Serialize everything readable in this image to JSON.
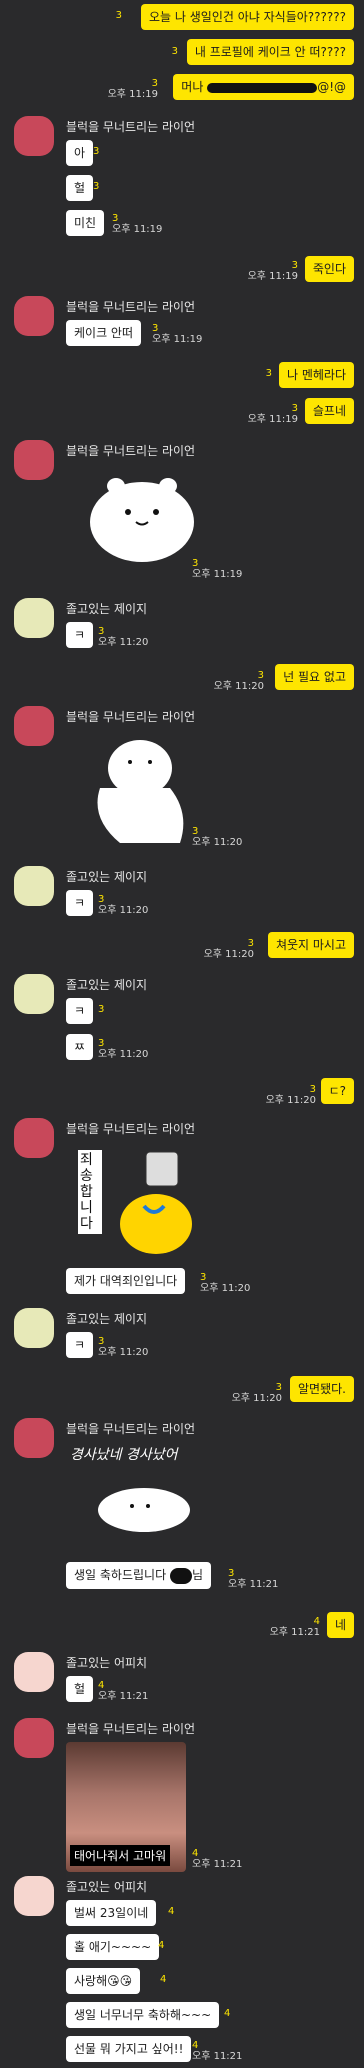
{
  "messages": {
    "me1": {
      "text": "오늘 나 생일인건 아냐 자식들아??????",
      "count": "3"
    },
    "me2": {
      "text": "내 프로필에 케이크 안 떠????",
      "count": "3"
    },
    "me3": {
      "text": "머나 ",
      "suffix": "@!@",
      "count": "3",
      "time": "오후 11:19"
    },
    "r1_name": "블럭을 무너트리는 라이언",
    "r1_a": {
      "text": "아",
      "count": "3"
    },
    "r1_b": {
      "text": "헐",
      "count": "3"
    },
    "r1_c": {
      "text": "미친",
      "count": "3",
      "time": "오후 11:19"
    },
    "me4": {
      "text": "죽인다",
      "count": "3",
      "time": "오후 11:19"
    },
    "r2_name": "블럭을 무너트리는 라이언",
    "r2_a": {
      "text": "케이크 안떠",
      "count": "3",
      "time": "오후 11:19"
    },
    "me5": {
      "text": "나 멘헤라다",
      "count": "3"
    },
    "me6": {
      "text": "슬프네",
      "count": "3",
      "time": "오후 11:19"
    },
    "r3_name": "블럭을 무너트리는 라이언",
    "r3_sticker": {
      "count": "3",
      "time": "오후 11:19"
    },
    "j1_name": "졸고있는 제이지",
    "j1_a": {
      "text": "ㅋ",
      "count": "3",
      "time": "오후 11:20"
    },
    "me7": {
      "text": "넌 필요 없고",
      "count": "3",
      "time": "오후 11:20"
    },
    "r4_name": "블럭을 무너트리는 라이언",
    "r4_sticker": {
      "count": "3",
      "time": "오후 11:20"
    },
    "j2_name": "졸고있는 제이지",
    "j2_a": {
      "text": "ㅋ",
      "count": "3",
      "time": "오후 11:20"
    },
    "me8": {
      "text": "쳐웃지 마시고",
      "count": "3",
      "time": "오후 11:20"
    },
    "j3_name": "졸고있는 제이지",
    "j3_a": {
      "text": "ㅋ",
      "count": "3"
    },
    "j3_b": {
      "text": "ㅉ",
      "count": "3",
      "time": "오후 11:20"
    },
    "me9": {
      "text": "ㄷ?",
      "count": "3",
      "time": "오후 11:20"
    },
    "r5_name": "블럭을 무너트리는 라이언",
    "r5_sticker_text": "죄송합니다",
    "r5_a": {
      "text": "제가 대역죄인입니다",
      "count": "3",
      "time": "오후 11:20"
    },
    "j4_name": "졸고있는 제이지",
    "j4_a": {
      "text": "ㅋ",
      "count": "3",
      "time": "오후 11:20"
    },
    "me10": {
      "text": "알면됐다.",
      "count": "3",
      "time": "오후 11:20"
    },
    "r6_name": "블럭을 무너트리는 라이언",
    "r6_sticker_text": "경사났네 경사났어",
    "r6_a": {
      "text": "생일 축하드립니다 ",
      "suffix": "님",
      "count": "3",
      "time": "오후 11:21"
    },
    "me11": {
      "text": "네",
      "count": "4",
      "time": "오후 11:21"
    },
    "p1_name": "졸고있는 어피치",
    "p1_a": {
      "text": "헐",
      "count": "4",
      "time": "오후 11:21"
    },
    "r7_name": "블럭을 무너트리는 라이언",
    "r7_photo": {
      "caption": "태어나줘서 고마워",
      "count": "4",
      "time": "오후 11:21"
    },
    "p2_name": "졸고있는 어피치",
    "p2_a": {
      "text": "벌써 23일이네",
      "count": "4"
    },
    "p2_b": {
      "text": "홀 애기~~~~",
      "count": "4"
    },
    "p2_c": {
      "text": "사랑해😘😘",
      "count": "4"
    },
    "p2_d": {
      "text": "생일 너무너무 축하해~~~",
      "count": "4"
    },
    "p2_e": {
      "text": "선물 뭐 가지고 싶어!!",
      "count": "4",
      "time": "오후 11:21"
    }
  },
  "colors": {
    "bg": "#2a2a2c",
    "me_bubble": "#fee500",
    "other_bubble": "#ffffff",
    "count": "#fee500"
  }
}
